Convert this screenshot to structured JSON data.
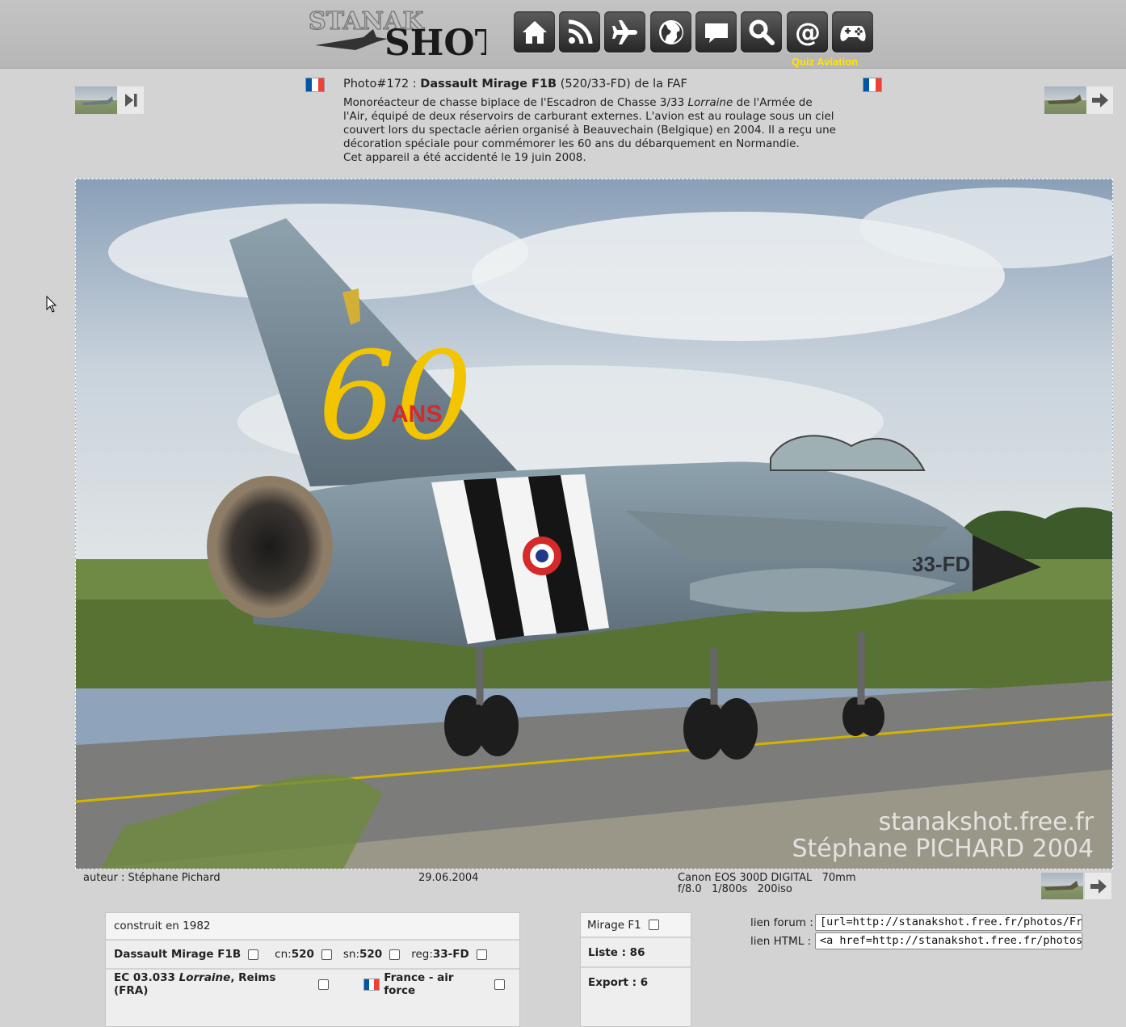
{
  "header": {
    "logo_text_top": "STANAK",
    "logo_text_bottom": "SHOT",
    "nav_icons": [
      "home-icon",
      "rss-icon",
      "airplane-icon",
      "globe-icon",
      "comment-icon",
      "search-icon",
      "at-icon",
      "gamepad-icon"
    ],
    "quiz_label": "Quiz Aviation",
    "quiz_color": "#ffe400"
  },
  "photo_info": {
    "prefix": "Photo#172 : ",
    "aircraft": "Dassault Mirage F1B",
    "suffix": " (520/33-FD) de la FAF",
    "desc_part1": "Monoréacteur de chasse biplace de l'Escadron de Chasse 3/33 ",
    "desc_italic": "Lorraine",
    "desc_part2": " de l'Armée de l'Air, équipé de deux réservoirs de carburant externes. L'avion est au roulage sous un ciel couvert lors du spectacle aérien organisé à Beauvechain (Belgique) en 2004. Il a reçu une décoration spéciale pour commémorer les 60 ans du débarquement en Normandie.",
    "desc_line2": "Cet appareil a été accidenté le 19 juin 2008."
  },
  "photo": {
    "tail_number": "60",
    "tail_text": "ANS",
    "nose_code": "33-FD",
    "watermark_line1": "stanakshot.free.fr",
    "watermark_line2": "Stéphane PICHARD 2004"
  },
  "meta": {
    "author": "auteur : Stéphane Pichard",
    "date": "29.06.2004",
    "camera": "Canon EOS 300D DIGITAL   70mm",
    "exposure": "f/8.0   1/800s   200iso"
  },
  "details": {
    "built": "construit en 1982",
    "type": "Dassault Mirage F1B",
    "cn_label": "cn: ",
    "cn": "520",
    "sn_label": "sn: ",
    "sn": "520",
    "reg_label": "reg: ",
    "reg": "33-FD",
    "unit_part1": "EC 03.033 ",
    "unit_italic": "Lorraine",
    "unit_part2": ", Reims (FRA)",
    "country": "France - air force"
  },
  "list_panel": {
    "type": "Mirage F1",
    "liste": "Liste : 86",
    "export": "Export : 6"
  },
  "links": {
    "forum_label": "lien forum :",
    "forum_value": "[url=http://stanakshot.free.fr/photos/France",
    "html_label": "lien HTML :",
    "html_value": "<a href=http://stanakshot.free.fr/photos/Fra"
  },
  "colors": {
    "flag_blue": "#0055a4",
    "flag_white": "#ffffff",
    "flag_red": "#ef4135"
  }
}
